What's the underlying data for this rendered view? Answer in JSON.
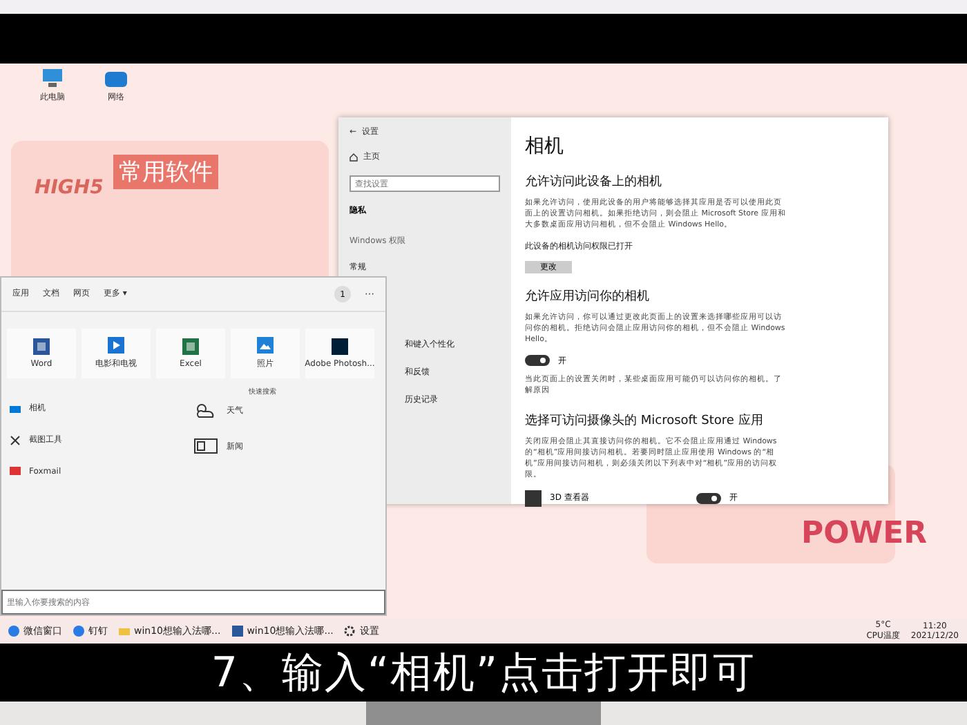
{
  "desktop_icons": [
    {
      "label": "此电脑",
      "kind": "computer"
    },
    {
      "label": "网络",
      "kind": "network"
    }
  ],
  "decor": {
    "high5": "HIGH5",
    "banner": "常用软件",
    "power": "POWER"
  },
  "settings": {
    "back": "←",
    "title": "设置",
    "home": "主页",
    "search_placeholder": "查找设置",
    "section": "隐私",
    "group": "Windows 权限",
    "nav": [
      {
        "label": "常规",
        "selected": false
      },
      {
        "label": "和键入个性化",
        "selected": false
      },
      {
        "label": "和反馈",
        "selected": false
      },
      {
        "label": "历史记录",
        "selected": false
      }
    ]
  },
  "camera_page": {
    "title": "相机",
    "sections": [
      {
        "heading": "允许访问此设备上的相机",
        "text": "如果允许访问，使用此设备的用户将能够选择其应用是否可以使用此页面上的设置访问相机。如果拒绝访问，则会阻止 Microsoft Store 应用和大多数桌面应用访问相机，但不会阻止 Windows Hello。",
        "status": "此设备的相机访问权限已打开",
        "button": "更改"
      },
      {
        "heading": "允许应用访问你的相机",
        "text": "如果允许访问，你可以通过更改此页面上的设置来选择哪些应用可以访问你的相机。拒绝访问会阻止应用访问你的相机，但不会阻止 Windows Hello。",
        "toggle": {
          "on": true,
          "label": "开"
        },
        "note": "当此页面上的设置关闭时，某些桌面应用可能仍可以访问你的相机。了解原因"
      },
      {
        "heading": "选择可访问摄像头的 Microsoft Store 应用",
        "text": "关闭应用会阻止其直接访问你的相机。它不会阻止应用通过 Windows 的“相机”应用间接访问相机。若要同时阻止应用使用 Windows 的“相机”应用间接访问相机，则必须关闭以下列表中对“相机”应用的访问权限。"
      }
    ],
    "apps": [
      {
        "name": "3D 查看器",
        "on": true,
        "label": "开"
      }
    ]
  },
  "search_panel": {
    "tabs": [
      {
        "label": "应用",
        "selected": false
      },
      {
        "label": "文档",
        "selected": false
      },
      {
        "label": "网页",
        "selected": false
      },
      {
        "label": "更多 ▾",
        "selected": false
      }
    ],
    "badge": "1",
    "more": "⋯",
    "top_apps": [
      {
        "name": "Word",
        "kind": "word",
        "color": "#2b579a"
      },
      {
        "name": "电影和电视",
        "kind": "video",
        "color": "#1b73d1"
      },
      {
        "name": "Excel",
        "kind": "excel",
        "color": "#217346"
      },
      {
        "name": "照片",
        "kind": "photo",
        "color": "#1f80d8"
      },
      {
        "name": "Adobe Photosh...",
        "kind": "ps",
        "color": "#001e36"
      }
    ],
    "quick_title": "快速搜索",
    "recent": [
      {
        "name": "相机",
        "kind": "camera"
      },
      {
        "name": "截图工具",
        "kind": "scissors"
      },
      {
        "name": "Foxmail",
        "kind": "mail"
      }
    ],
    "quick": [
      {
        "name": "天气",
        "kind": "weather"
      },
      {
        "name": "新闻",
        "kind": "news"
      }
    ],
    "placeholder": "里输入你要搜索的内容"
  },
  "taskbar": {
    "items": [
      {
        "label": "微信窗口",
        "kind": "app"
      },
      {
        "label": "钉钉",
        "kind": "app"
      },
      {
        "label": "win10想输入法哪...",
        "kind": "folder"
      },
      {
        "label": "win10想输入法哪...",
        "kind": "word"
      },
      {
        "label": "设置",
        "kind": "gear"
      }
    ],
    "temp": "5°C",
    "cpu": "CPU温度",
    "time": "11:20",
    "date": "2021/12/20"
  },
  "subtitle": "7、输入“相机”点击打开即可"
}
